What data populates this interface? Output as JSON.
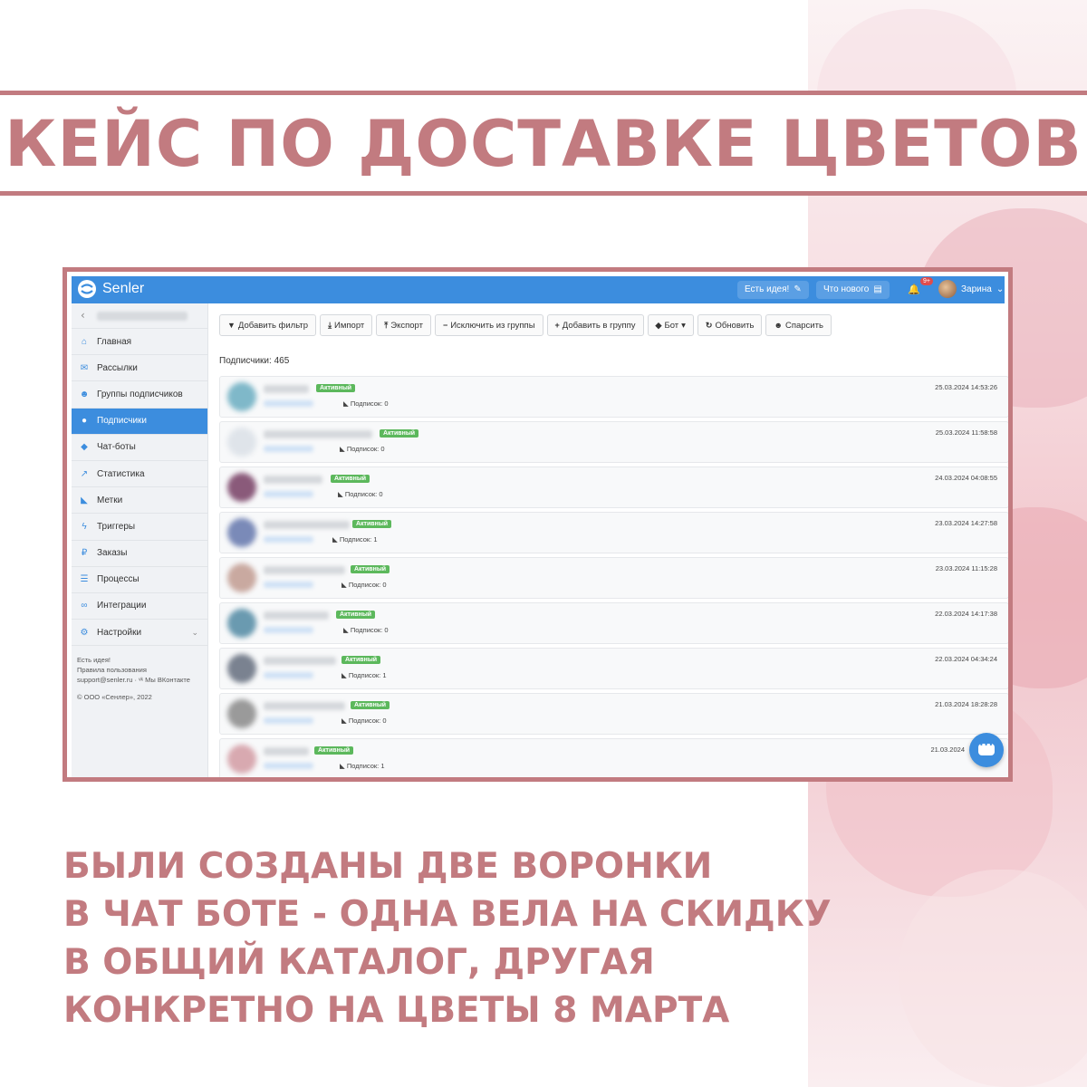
{
  "headline": "КЕЙС ПО ДОСТАВКЕ ЦВЕТОВ",
  "bottom_text": [
    "БЫЛИ СОЗДАНЫ ДВЕ ВОРОНКИ",
    "В ЧАТ БОТЕ - ОДНА ВЕЛА НА СКИДКУ",
    "В ОБЩИЙ КАТАЛОГ, ДРУГАЯ",
    "КОНКРЕТНО НА ЦВЕТЫ 8 МАРТА"
  ],
  "colors": {
    "accent": "#c27b80",
    "brand_blue": "#3c8dde",
    "status_green": "#5cb85c"
  },
  "app": {
    "logo": "Senler",
    "topbar": {
      "idea_button": "Есть идея!",
      "news_button": "Что нового",
      "notif_badge": "9+",
      "user_name": "Зарина"
    },
    "sidebar": {
      "items": [
        {
          "label": "Главная",
          "icon": "home-icon"
        },
        {
          "label": "Рассылки",
          "icon": "envelope-icon"
        },
        {
          "label": "Группы подписчиков",
          "icon": "users-icon"
        },
        {
          "label": "Подписчики",
          "icon": "user-icon"
        },
        {
          "label": "Чат-боты",
          "icon": "android-icon"
        },
        {
          "label": "Статистика",
          "icon": "chart-icon"
        },
        {
          "label": "Метки",
          "icon": "tag-icon"
        },
        {
          "label": "Триггеры",
          "icon": "bolt-icon"
        },
        {
          "label": "Заказы",
          "icon": "ruble-icon"
        },
        {
          "label": "Процессы",
          "icon": "list-icon"
        },
        {
          "label": "Интеграции",
          "icon": "link-icon"
        },
        {
          "label": "Настройки",
          "icon": "gears-icon"
        }
      ],
      "footer": {
        "idea": "Есть идея!",
        "rules": "Правила пользования",
        "support": "support@senler.ru · ",
        "vk": "Мы ВКонтакте",
        "copyright": "© ООО «Сенлер», 2022"
      }
    },
    "toolbar": {
      "add_filter": "Добавить фильтр",
      "import": "Импорт",
      "export": "Экспорт",
      "exclude": "Исключить из группы",
      "add_group": "Добавить в группу",
      "bot": "Бот",
      "refresh": "Обновить",
      "parse": "Спарсить"
    },
    "subscribers_count": "Подписчики: 465",
    "rows": [
      {
        "status": "Активный",
        "subs": "Подписок: 0",
        "date": "25.03.2024 14:53:26"
      },
      {
        "status": "Активный",
        "subs": "Подписок: 0",
        "date": "25.03.2024 11:58:58"
      },
      {
        "status": "Активный",
        "subs": "Подписок: 0",
        "date": "24.03.2024 04:08:55"
      },
      {
        "status": "Активный",
        "subs": "Подписок: 1",
        "date": "23.03.2024 14:27:58"
      },
      {
        "status": "Активный",
        "subs": "Подписок: 0",
        "date": "23.03.2024 11:15:28"
      },
      {
        "status": "Активный",
        "subs": "Подписок: 0",
        "date": "22.03.2024 14:17:38"
      },
      {
        "status": "Активный",
        "subs": "Подписок: 1",
        "date": "22.03.2024 04:34:24"
      },
      {
        "status": "Активный",
        "subs": "Подписок: 0",
        "date": "21.03.2024 18:28:28"
      },
      {
        "status": "Активный",
        "subs": "Подписок: 1",
        "date": "21.03.2024"
      }
    ]
  }
}
